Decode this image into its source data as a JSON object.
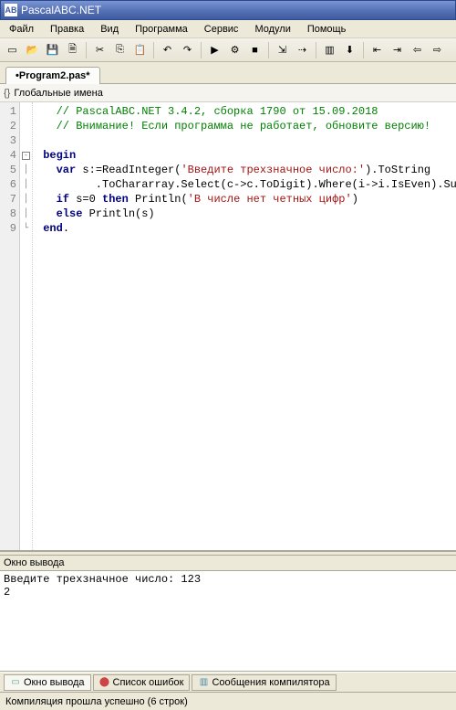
{
  "window": {
    "title": "PascalABC.NET",
    "icon_label": "AB"
  },
  "menu": [
    "Файл",
    "Правка",
    "Вид",
    "Программа",
    "Сервис",
    "Модули",
    "Помощь"
  ],
  "toolbar_icons": [
    {
      "name": "new-file-icon",
      "glyph": "▭"
    },
    {
      "name": "open-file-icon",
      "glyph": "📂"
    },
    {
      "name": "save-icon",
      "glyph": "💾"
    },
    {
      "name": "save-all-icon",
      "glyph": "🗎"
    },
    {
      "name": "sep"
    },
    {
      "name": "cut-icon",
      "glyph": "✂"
    },
    {
      "name": "copy-icon",
      "glyph": "⎘"
    },
    {
      "name": "paste-icon",
      "glyph": "📋"
    },
    {
      "name": "sep"
    },
    {
      "name": "undo-icon",
      "glyph": "↶"
    },
    {
      "name": "redo-icon",
      "glyph": "↷"
    },
    {
      "name": "sep"
    },
    {
      "name": "run-icon",
      "glyph": "▶"
    },
    {
      "name": "compile-icon",
      "glyph": "⚙"
    },
    {
      "name": "stop-icon",
      "glyph": "■"
    },
    {
      "name": "sep"
    },
    {
      "name": "step-into-icon",
      "glyph": "⇲"
    },
    {
      "name": "step-over-icon",
      "glyph": "⇢"
    },
    {
      "name": "sep"
    },
    {
      "name": "form-designer-icon",
      "glyph": "▥"
    },
    {
      "name": "save-exe-icon",
      "glyph": "⬇"
    },
    {
      "name": "sep"
    },
    {
      "name": "outdent-icon",
      "glyph": "⇤"
    },
    {
      "name": "indent-icon",
      "glyph": "⇥"
    },
    {
      "name": "nav-back-icon",
      "glyph": "⇦"
    },
    {
      "name": "nav-fwd-icon",
      "glyph": "⇨"
    }
  ],
  "tab": {
    "label": "•Program2.pas*"
  },
  "breadcrumb": {
    "icon": "{}",
    "label": "Глобальные имена"
  },
  "code": {
    "lines": [
      {
        "n": 1,
        "fold": "",
        "html": "   <span class='c-comment'>// PascalABC.NET 3.4.2, сборка 1790 от 15.09.2018</span>"
      },
      {
        "n": 2,
        "fold": "",
        "html": "   <span class='c-comment'>// Внимание! Если программа не работает, обновите версию!</span>"
      },
      {
        "n": 3,
        "fold": "",
        "html": ""
      },
      {
        "n": 4,
        "fold": "box",
        "html": " <span class='c-kw'>begin</span>"
      },
      {
        "n": 5,
        "fold": "line",
        "html": "   <span class='c-kw'>var</span> s:=ReadInteger(<span class='c-str'>'Введите трехзначное число:'</span>).ToString"
      },
      {
        "n": 6,
        "fold": "line",
        "html": "         .ToChararray.Select(c-&gt;c.ToDigit).Where(i-&gt;i.IsEven).Sum;"
      },
      {
        "n": 7,
        "fold": "line",
        "html": "   <span class='c-kw'>if</span> s=<span class='c-num'>0</span> <span class='c-kw'>then</span> Println(<span class='c-str'>'В числе нет четных цифр'</span>)"
      },
      {
        "n": 8,
        "fold": "line",
        "html": "   <span class='c-kw'>else</span> Println(s)"
      },
      {
        "n": 9,
        "fold": "end",
        "html": " <span class='c-kw'>end</span>."
      }
    ]
  },
  "output": {
    "title": "Окно вывода",
    "text": "Введите трехзначное число: 123\n2"
  },
  "bottom_tabs": [
    {
      "name": "output-tab",
      "icon": "▭",
      "label": "Окно вывода",
      "active": true,
      "color": "#5a8"
    },
    {
      "name": "errors-tab",
      "icon": "⬤",
      "label": "Список ошибок",
      "active": false,
      "color": "#c44"
    },
    {
      "name": "compiler-tab",
      "icon": "▥",
      "label": "Сообщения компилятора",
      "active": false,
      "color": "#48a"
    }
  ],
  "status": "Компиляция прошла успешно (6 строк)"
}
